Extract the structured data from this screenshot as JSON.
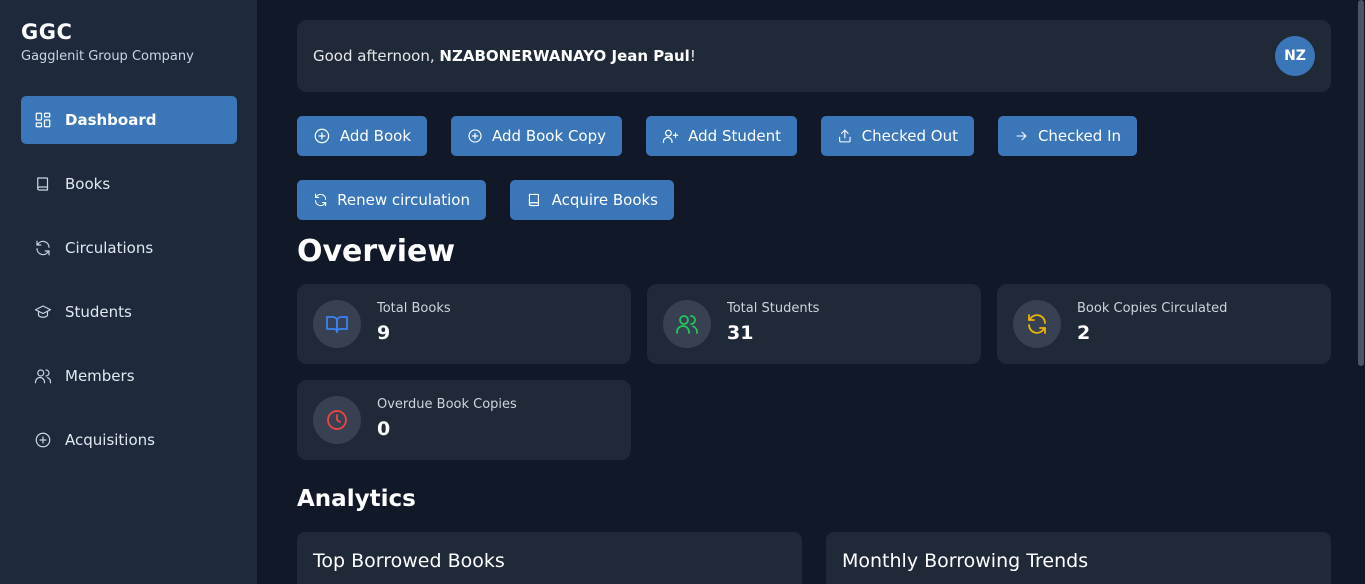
{
  "brand": {
    "title": "GGC",
    "subtitle": "Gagglenit Group Company"
  },
  "sidebar": {
    "items": [
      {
        "label": "Dashboard",
        "icon": "dashboard-icon",
        "active": true
      },
      {
        "label": "Books",
        "icon": "book-icon"
      },
      {
        "label": "Circulations",
        "icon": "refresh-icon"
      },
      {
        "label": "Students",
        "icon": "graduation-cap-icon"
      },
      {
        "label": "Members",
        "icon": "users-icon"
      },
      {
        "label": "Acquisitions",
        "icon": "plus-circle-icon"
      }
    ]
  },
  "greeting": {
    "prefix": "Good afternoon, ",
    "name": "NZABONERWANAYO Jean Paul",
    "suffix": "!"
  },
  "avatar": {
    "initials": "NZ"
  },
  "actions": [
    {
      "label": "Add Book",
      "icon": "plus-circle-icon"
    },
    {
      "label": "Add Book Copy",
      "icon": "plus-circle-icon"
    },
    {
      "label": "Add Student",
      "icon": "user-plus-icon"
    },
    {
      "label": "Checked Out",
      "icon": "upload-icon"
    },
    {
      "label": "Checked In",
      "icon": "arrow-right-icon"
    },
    {
      "label": "Renew circulation",
      "icon": "refresh-icon"
    },
    {
      "label": "Acquire Books",
      "icon": "book-icon"
    }
  ],
  "overview": {
    "title": "Overview",
    "stats": [
      {
        "label": "Total Books",
        "value": "9",
        "icon": "open-book-icon",
        "color": "#3b82f6"
      },
      {
        "label": "Total Students",
        "value": "31",
        "icon": "users-icon",
        "color": "#22c55e"
      },
      {
        "label": "Book Copies Circulated",
        "value": "2",
        "icon": "refresh-icon",
        "color": "#eab308"
      },
      {
        "label": "Overdue Book Copies",
        "value": "0",
        "icon": "clock-icon",
        "color": "#ef4444"
      }
    ]
  },
  "analytics": {
    "title": "Analytics",
    "panels": [
      {
        "title": "Top Borrowed Books"
      },
      {
        "title": "Monthly Borrowing Trends"
      }
    ]
  },
  "colors": {
    "accent": "#3b76b9",
    "sidebar": "#1e293b",
    "background": "#111827",
    "card": "#1f2937"
  }
}
